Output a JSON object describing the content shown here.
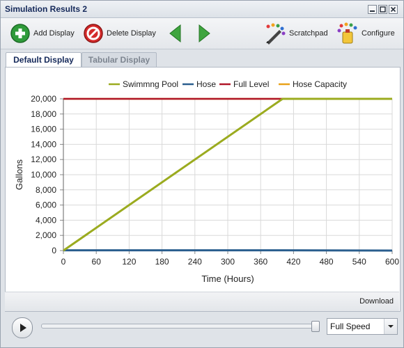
{
  "window": {
    "title": "Simulation Results 2"
  },
  "toolbar": {
    "add_display": "Add Display",
    "delete_display": "Delete Display",
    "scratchpad": "Scratchpad",
    "configure": "Configure"
  },
  "tabs": [
    {
      "label": "Default Display"
    },
    {
      "label": "Tabular Display"
    }
  ],
  "footer": {
    "download": "Download"
  },
  "playback": {
    "speed": "Full Speed"
  },
  "chart_data": {
    "type": "line",
    "xlabel": "Time (Hours)",
    "ylabel": "Gallons",
    "xlim": [
      0,
      600
    ],
    "ylim": [
      0,
      20000
    ],
    "xticks": [
      0,
      60,
      120,
      180,
      240,
      300,
      360,
      420,
      480,
      540,
      600
    ],
    "yticks": [
      0,
      2000,
      4000,
      6000,
      8000,
      10000,
      12000,
      14000,
      16000,
      18000,
      20000
    ],
    "xtick_labels": [
      "0",
      "60",
      "120",
      "180",
      "240",
      "300",
      "360",
      "420",
      "480",
      "540",
      "600"
    ],
    "ytick_labels": [
      "0",
      "2,000",
      "4,000",
      "6,000",
      "8,000",
      "10,000",
      "12,000",
      "14,000",
      "16,000",
      "18,000",
      "20,000"
    ],
    "grid": true,
    "legend_position": "top",
    "series": [
      {
        "name": "Swimmng Pool",
        "color": "#9bab1f",
        "x": [
          0,
          400,
          600
        ],
        "y": [
          0,
          20000,
          20000
        ]
      },
      {
        "name": "Hose",
        "color": "#2a5e8e",
        "x": [
          0,
          400,
          600
        ],
        "y": [
          40,
          40,
          0
        ]
      },
      {
        "name": "Full Level",
        "color": "#b01628",
        "x": [
          0,
          600
        ],
        "y": [
          20000,
          20000
        ]
      },
      {
        "name": "Hose Capacity",
        "color": "#e8a21a",
        "x": [
          0,
          600
        ],
        "y": [
          20000,
          20000
        ]
      }
    ]
  }
}
